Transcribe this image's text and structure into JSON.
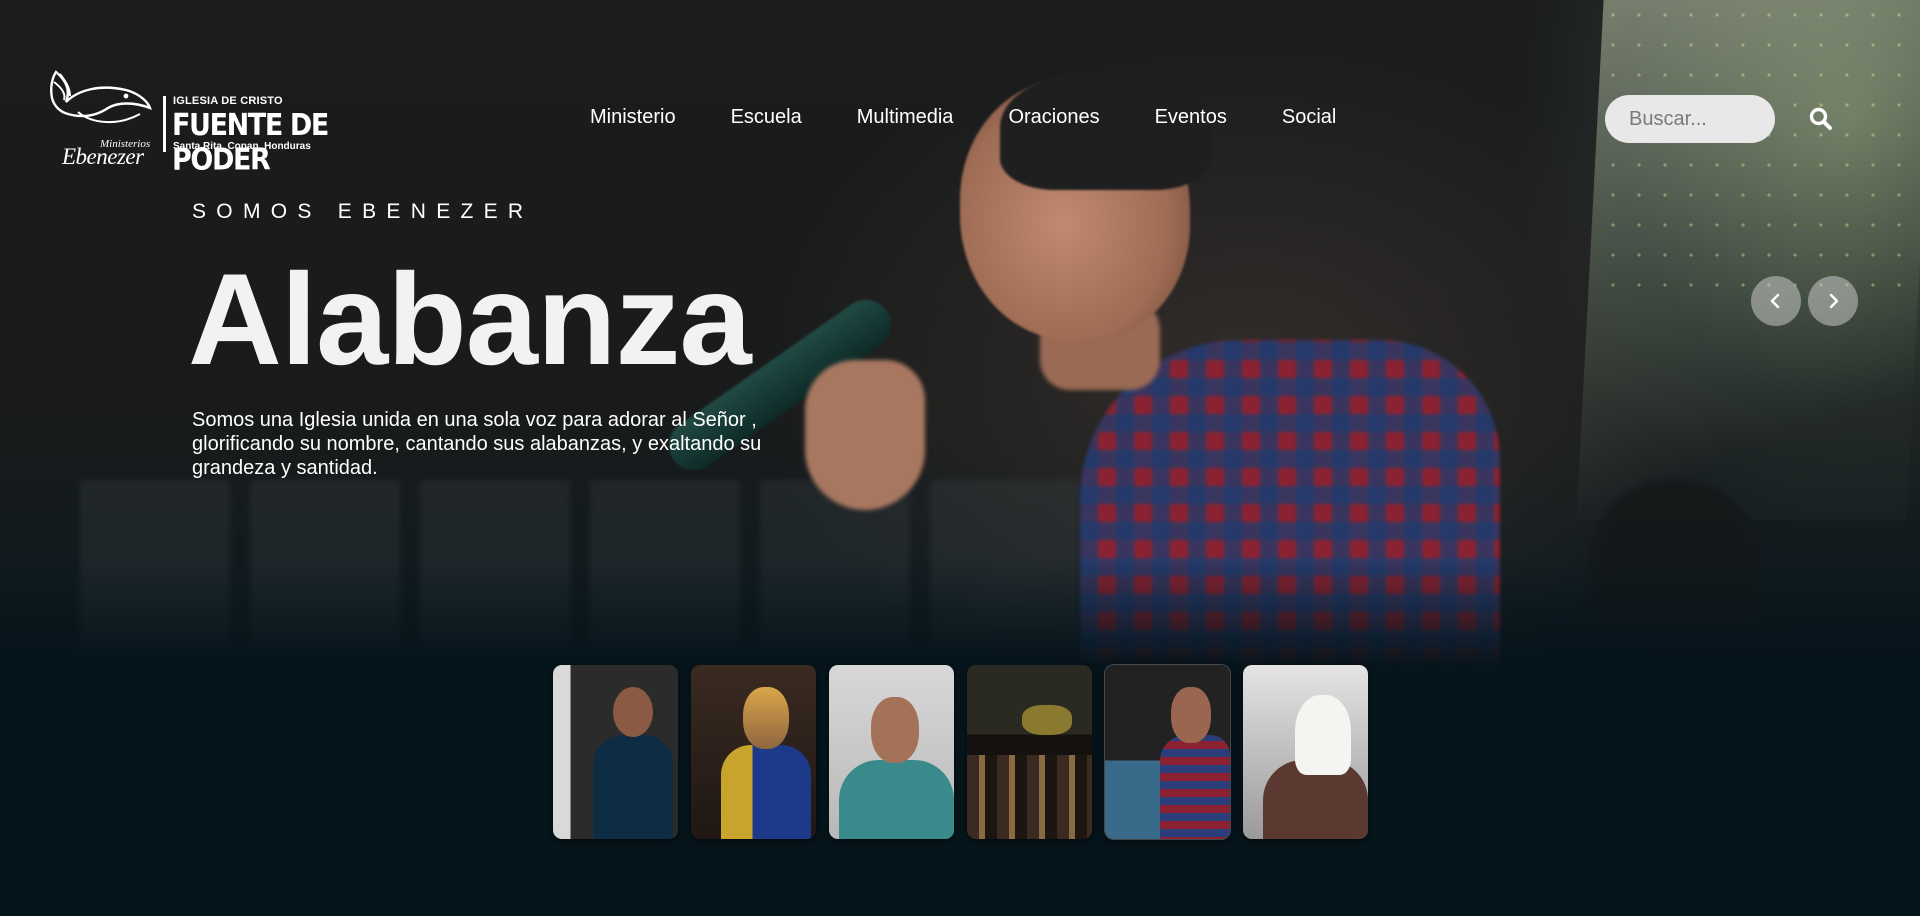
{
  "brand": {
    "logo_ministerios": "Ministerios",
    "logo_ebenezer": "Ebenezer",
    "church_line": "IGLESIA DE CRISTO",
    "church_name": "FUENTE DE PODER",
    "location": "Santa Rita, Copan, Honduras"
  },
  "nav": {
    "items": [
      {
        "label": "Ministerio"
      },
      {
        "label": "Escuela"
      },
      {
        "label": "Multimedia"
      },
      {
        "label": "Oraciones"
      },
      {
        "label": "Eventos"
      },
      {
        "label": "Social"
      }
    ]
  },
  "search": {
    "placeholder": "Buscar...",
    "value": "",
    "icon": "search-icon"
  },
  "hero": {
    "eyebrow": "SOMOS EBENEZER",
    "title": "Alabanza",
    "description": "Somos una Iglesia unida en una sola voz para adorar al Señor , glorificando su nombre, cantando sus alabanzas, y exaltando su grandeza y santidad."
  },
  "slider": {
    "prev_icon": "chevron-left-icon",
    "next_icon": "chevron-right-icon",
    "active_index": 4,
    "thumbnail_count": 6
  },
  "colors": {
    "background": "#06141b",
    "text": "#ffffff",
    "search_bg": "#e8e8e8"
  }
}
